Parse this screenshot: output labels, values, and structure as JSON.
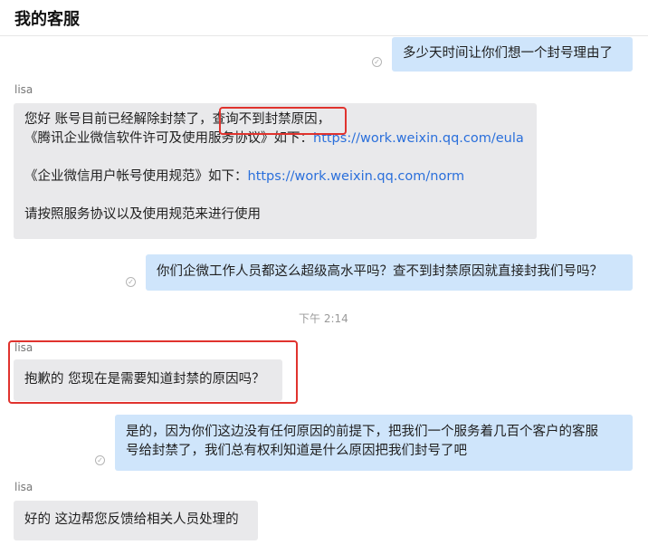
{
  "header": {
    "title": "我的客服"
  },
  "messages": {
    "m1": {
      "text": "多少天时间让你们想一个封号理由了"
    },
    "m2": {
      "sender": "lisa",
      "l1_a": "您好 账号目前已经解除封禁了，",
      "l1_b": "查询不到封禁原因，",
      "l2_a": "《腾讯企业微信软件许可及使用服务协议》如下：",
      "l2_link": "https://work.weixin.qq.com/eula",
      "l3_a": "《企业微信用户帐号使用规范》如下：",
      "l3_link": "https://work.weixin.qq.com/norm",
      "l4": "请按照服务协议以及使用规范来进行使用"
    },
    "m3": {
      "text": "你们企微工作人员都这么超级高水平吗？查不到封禁原因就直接封我们号吗？"
    },
    "timestamp": "下午 2:14",
    "m4": {
      "sender": "lisa",
      "text": "抱歉的 您现在是需要知道封禁的原因吗？"
    },
    "m5": {
      "l1": "是的，因为你们这边没有任何原因的前提下，把我们一个服务着几百个客户的客服",
      "l2": "号给封禁了，我们总有权利知道是什么原因把我们封号了吧"
    },
    "m6": {
      "sender": "lisa",
      "text": "好的 这边帮您反馈给相关人员处理的"
    }
  },
  "colors": {
    "highlight": "#e0332e",
    "outgoing": "#cfe5fb",
    "incoming": "#e9e9eb",
    "link": "#2a6fdb"
  },
  "icons": {
    "read_receipt": "check-circle-icon"
  }
}
